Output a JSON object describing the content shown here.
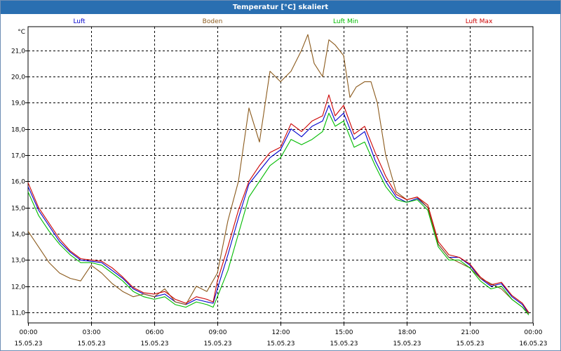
{
  "window": {
    "title": "Temperatur [°C] skaliert"
  },
  "chart_data": {
    "type": "line",
    "title": "Temperatur [°C] skaliert",
    "ylabel": "°C",
    "xlabel": "",
    "ylim": [
      10.6,
      21.9
    ],
    "xlim": [
      0,
      24
    ],
    "x_unit": "hours since 15.05.23 00:00",
    "grid": true,
    "legend_position": "top",
    "x_ticks": [
      {
        "time": "00:00",
        "date": "15.05.23"
      },
      {
        "time": "03:00",
        "date": "15.05.23"
      },
      {
        "time": "06:00",
        "date": "15.05.23"
      },
      {
        "time": "09:00",
        "date": "15.05.23"
      },
      {
        "time": "12:00",
        "date": "15.05.23"
      },
      {
        "time": "15:00",
        "date": "15.05.23"
      },
      {
        "time": "18:00",
        "date": "15.05.23"
      },
      {
        "time": "21:00",
        "date": "15.05.23"
      },
      {
        "time": "00:00",
        "date": "16.05.23"
      }
    ],
    "y_ticks": [
      "11,0",
      "12,0",
      "13,0",
      "14,0",
      "15,0",
      "16,0",
      "17,0",
      "18,0",
      "19,0",
      "20,0",
      "21,0"
    ],
    "y_tick_values": [
      11,
      12,
      13,
      14,
      15,
      16,
      17,
      18,
      19,
      20,
      21
    ],
    "series": [
      {
        "name": "Luft",
        "color": "#0000cc",
        "points": [
          [
            0,
            15.8
          ],
          [
            0.5,
            14.9
          ],
          [
            1,
            14.3
          ],
          [
            1.5,
            13.7
          ],
          [
            2,
            13.3
          ],
          [
            2.5,
            13.0
          ],
          [
            3,
            12.95
          ],
          [
            3.5,
            12.9
          ],
          [
            4,
            12.6
          ],
          [
            4.5,
            12.3
          ],
          [
            5,
            11.9
          ],
          [
            5.5,
            11.7
          ],
          [
            6,
            11.6
          ],
          [
            6.5,
            11.7
          ],
          [
            7,
            11.4
          ],
          [
            7.5,
            11.3
          ],
          [
            8,
            11.5
          ],
          [
            8.5,
            11.4
          ],
          [
            8.8,
            11.35
          ],
          [
            9,
            11.9
          ],
          [
            9.5,
            13.2
          ],
          [
            10,
            14.6
          ],
          [
            10.5,
            15.9
          ],
          [
            11,
            16.4
          ],
          [
            11.5,
            16.9
          ],
          [
            12,
            17.2
          ],
          [
            12.5,
            18.0
          ],
          [
            13,
            17.7
          ],
          [
            13.5,
            18.1
          ],
          [
            14,
            18.3
          ],
          [
            14.3,
            18.9
          ],
          [
            14.6,
            18.3
          ],
          [
            15,
            18.6
          ],
          [
            15.5,
            17.6
          ],
          [
            16,
            17.9
          ],
          [
            16.5,
            16.8
          ],
          [
            17,
            16.0
          ],
          [
            17.5,
            15.4
          ],
          [
            18,
            15.2
          ],
          [
            18.5,
            15.35
          ],
          [
            19,
            15.0
          ],
          [
            19.5,
            13.6
          ],
          [
            20,
            13.1
          ],
          [
            20.5,
            13.1
          ],
          [
            21,
            12.8
          ],
          [
            21.5,
            12.3
          ],
          [
            22,
            12.0
          ],
          [
            22.5,
            12.1
          ],
          [
            23,
            11.6
          ],
          [
            23.5,
            11.3
          ],
          [
            23.8,
            10.95
          ]
        ]
      },
      {
        "name": "Boden",
        "color": "#8b5a1c",
        "points": [
          [
            0,
            14.1
          ],
          [
            0.5,
            13.5
          ],
          [
            1,
            12.9
          ],
          [
            1.5,
            12.5
          ],
          [
            2,
            12.3
          ],
          [
            2.5,
            12.2
          ],
          [
            3,
            12.8
          ],
          [
            3.5,
            12.5
          ],
          [
            4,
            12.1
          ],
          [
            4.5,
            11.8
          ],
          [
            5,
            11.6
          ],
          [
            5.5,
            11.7
          ],
          [
            6,
            11.6
          ],
          [
            6.5,
            11.9
          ],
          [
            7,
            11.4
          ],
          [
            7.5,
            11.3
          ],
          [
            8,
            12.0
          ],
          [
            8.5,
            11.8
          ],
          [
            9,
            12.5
          ],
          [
            9.5,
            14.5
          ],
          [
            10,
            16.0
          ],
          [
            10.5,
            18.8
          ],
          [
            11,
            17.5
          ],
          [
            11.5,
            20.2
          ],
          [
            12,
            19.8
          ],
          [
            12.5,
            20.2
          ],
          [
            13,
            21.0
          ],
          [
            13.3,
            21.6
          ],
          [
            13.6,
            20.5
          ],
          [
            14,
            20.0
          ],
          [
            14.3,
            21.4
          ],
          [
            14.6,
            21.2
          ],
          [
            15,
            20.8
          ],
          [
            15.3,
            19.2
          ],
          [
            15.6,
            19.6
          ],
          [
            16,
            19.8
          ],
          [
            16.3,
            19.8
          ],
          [
            16.6,
            19.0
          ],
          [
            17,
            17.0
          ],
          [
            17.5,
            15.6
          ],
          [
            18,
            15.3
          ],
          [
            18.5,
            15.4
          ],
          [
            19,
            15.0
          ],
          [
            19.5,
            13.6
          ],
          [
            20,
            13.1
          ],
          [
            20.5,
            12.9
          ],
          [
            21,
            12.7
          ],
          [
            21.5,
            12.3
          ],
          [
            22,
            12.1
          ],
          [
            22.5,
            11.9
          ],
          [
            23,
            11.5
          ],
          [
            23.5,
            11.2
          ],
          [
            23.8,
            10.95
          ]
        ]
      },
      {
        "name": "Luft Min",
        "color": "#00bb00",
        "points": [
          [
            0,
            15.6
          ],
          [
            0.5,
            14.7
          ],
          [
            1,
            14.1
          ],
          [
            1.5,
            13.6
          ],
          [
            2,
            13.2
          ],
          [
            2.5,
            12.9
          ],
          [
            3,
            12.9
          ],
          [
            3.5,
            12.8
          ],
          [
            4,
            12.5
          ],
          [
            4.5,
            12.2
          ],
          [
            5,
            11.8
          ],
          [
            5.5,
            11.6
          ],
          [
            6,
            11.5
          ],
          [
            6.5,
            11.6
          ],
          [
            7,
            11.3
          ],
          [
            7.5,
            11.2
          ],
          [
            8,
            11.4
          ],
          [
            8.5,
            11.3
          ],
          [
            8.8,
            11.2
          ],
          [
            9,
            11.6
          ],
          [
            9.5,
            12.6
          ],
          [
            10,
            14.0
          ],
          [
            10.5,
            15.4
          ],
          [
            11,
            16.0
          ],
          [
            11.5,
            16.6
          ],
          [
            12,
            16.9
          ],
          [
            12.5,
            17.6
          ],
          [
            13,
            17.4
          ],
          [
            13.5,
            17.6
          ],
          [
            14,
            17.9
          ],
          [
            14.3,
            18.6
          ],
          [
            14.6,
            18.1
          ],
          [
            15,
            18.3
          ],
          [
            15.5,
            17.3
          ],
          [
            16,
            17.5
          ],
          [
            16.5,
            16.6
          ],
          [
            17,
            15.8
          ],
          [
            17.5,
            15.3
          ],
          [
            18,
            15.2
          ],
          [
            18.5,
            15.3
          ],
          [
            19,
            14.9
          ],
          [
            19.5,
            13.5
          ],
          [
            20,
            13.0
          ],
          [
            20.5,
            13.0
          ],
          [
            21,
            12.7
          ],
          [
            21.5,
            12.2
          ],
          [
            22,
            11.9
          ],
          [
            22.5,
            12.0
          ],
          [
            23,
            11.5
          ],
          [
            23.5,
            11.2
          ],
          [
            23.8,
            10.9
          ]
        ]
      },
      {
        "name": "Luft Max",
        "color": "#cc0000",
        "points": [
          [
            0,
            15.95
          ],
          [
            0.5,
            15.0
          ],
          [
            1,
            14.4
          ],
          [
            1.5,
            13.8
          ],
          [
            2,
            13.35
          ],
          [
            2.5,
            13.05
          ],
          [
            3,
            13.0
          ],
          [
            3.5,
            12.95
          ],
          [
            4,
            12.7
          ],
          [
            4.5,
            12.35
          ],
          [
            5,
            11.95
          ],
          [
            5.5,
            11.75
          ],
          [
            6,
            11.7
          ],
          [
            6.5,
            11.8
          ],
          [
            7,
            11.5
          ],
          [
            7.5,
            11.35
          ],
          [
            8,
            11.6
          ],
          [
            8.5,
            11.5
          ],
          [
            8.8,
            11.4
          ],
          [
            9,
            12.2
          ],
          [
            9.5,
            13.5
          ],
          [
            10,
            14.9
          ],
          [
            10.5,
            16.0
          ],
          [
            11,
            16.6
          ],
          [
            11.5,
            17.1
          ],
          [
            12,
            17.3
          ],
          [
            12.5,
            18.2
          ],
          [
            13,
            17.9
          ],
          [
            13.5,
            18.3
          ],
          [
            14,
            18.5
          ],
          [
            14.3,
            19.3
          ],
          [
            14.6,
            18.5
          ],
          [
            15,
            18.9
          ],
          [
            15.5,
            17.8
          ],
          [
            16,
            18.1
          ],
          [
            16.5,
            17.1
          ],
          [
            17,
            16.2
          ],
          [
            17.5,
            15.5
          ],
          [
            18,
            15.3
          ],
          [
            18.5,
            15.4
          ],
          [
            19,
            15.1
          ],
          [
            19.5,
            13.7
          ],
          [
            20,
            13.2
          ],
          [
            20.5,
            13.1
          ],
          [
            21,
            12.85
          ],
          [
            21.5,
            12.35
          ],
          [
            22,
            12.05
          ],
          [
            22.5,
            12.15
          ],
          [
            23,
            11.65
          ],
          [
            23.5,
            11.35
          ],
          [
            23.8,
            11.0
          ]
        ]
      }
    ]
  }
}
